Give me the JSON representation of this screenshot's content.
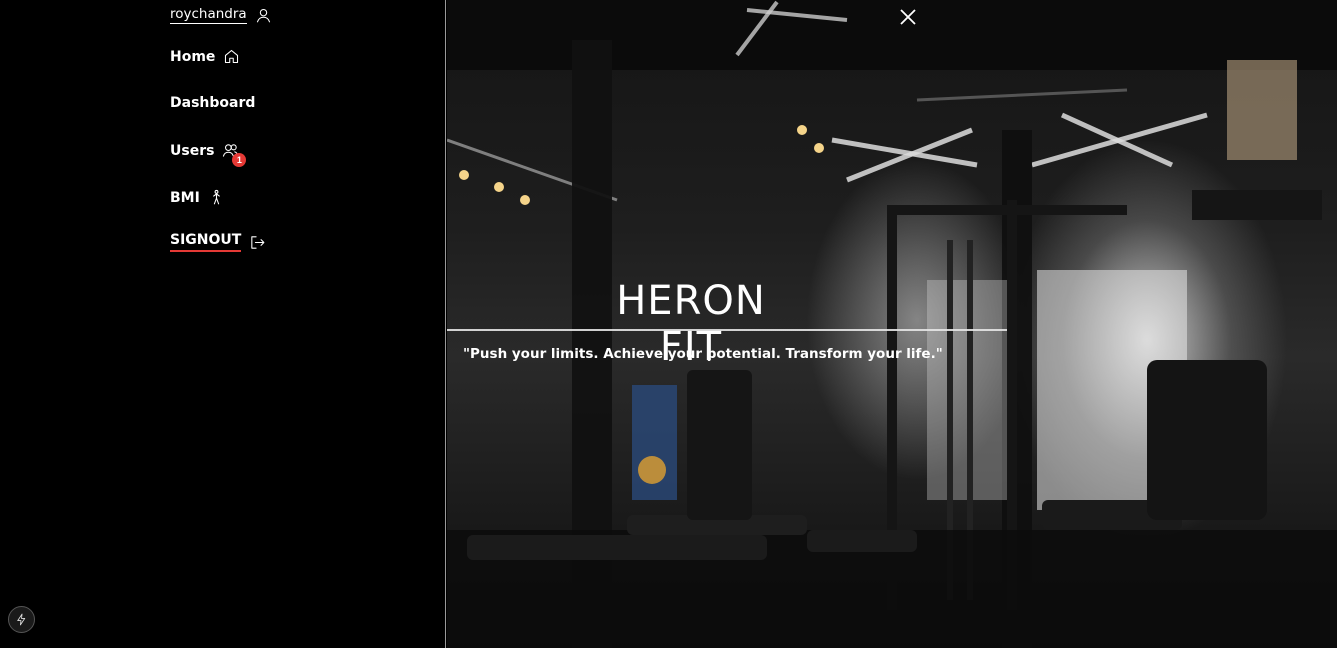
{
  "sidebar": {
    "user": {
      "label": "roychandra",
      "icon": "user-icon"
    },
    "items": [
      {
        "label": "Home",
        "icon": "home-icon"
      },
      {
        "label": "Dashboard"
      },
      {
        "label": "Users",
        "icon": "users-icon",
        "badge": "1"
      },
      {
        "label": "BMI",
        "icon": "person-walking-icon"
      },
      {
        "label": "SIGNOUT",
        "icon": "logout-icon"
      }
    ],
    "bolt_icon": "bolt-icon"
  },
  "hero": {
    "title": "HERON FIT",
    "quote": "\"Push your limits. Achieve your potential. Transform your life.\"",
    "close_icon": "close-icon"
  },
  "colors": {
    "background": "#000000",
    "accent": "#e53935",
    "text": "#ffffff"
  }
}
